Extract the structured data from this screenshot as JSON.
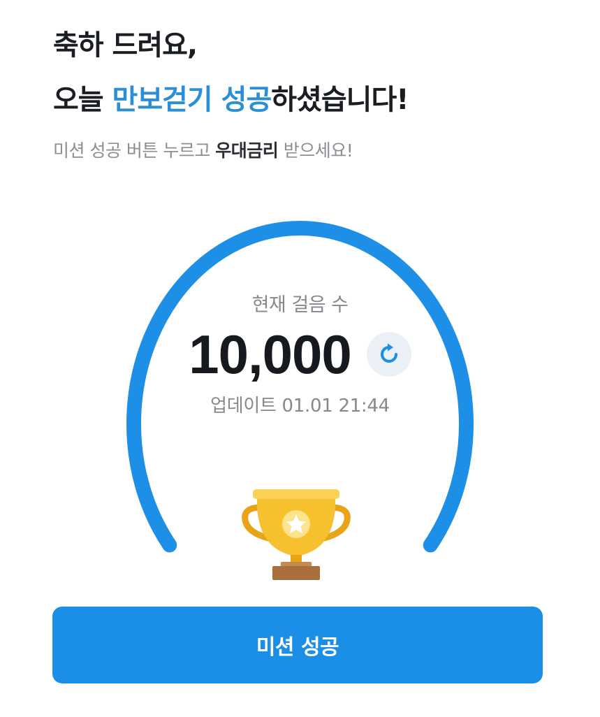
{
  "header": {
    "line1": "축하 드려요,",
    "line2_prefix": "오늘 ",
    "line2_highlight": "만보걷기 성공",
    "line2_suffix": "하셨습니다!"
  },
  "subtitle": {
    "prefix": "미션 성공 버튼 누르고 ",
    "emphasis": "우대금리",
    "suffix": " 받으세요!"
  },
  "steps": {
    "label": "현재 걸음 수",
    "value": "10,000",
    "updated": "업데이트 01.01 21:44",
    "goal_progress": 1.0
  },
  "icons": {
    "refresh": "refresh-icon",
    "trophy": "trophy-icon"
  },
  "button": {
    "label": "미션 성공"
  },
  "colors": {
    "accent": "#1b8fe8",
    "highlight_text": "#2a8fd6",
    "gauge": "#1e8fe6",
    "trophy_gold": "#f7c02e",
    "trophy_base": "#a86f3c"
  }
}
